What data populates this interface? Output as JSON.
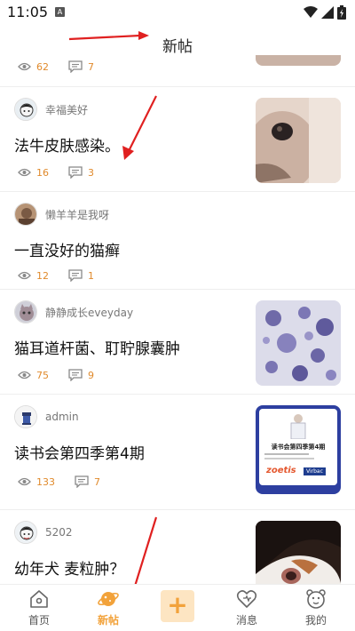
{
  "status_bar": {
    "time": "11:05",
    "notification_label": "A"
  },
  "header": {
    "title": "新帖"
  },
  "partial_post": {
    "views": "62",
    "comments": "7"
  },
  "posts": [
    {
      "author": "幸福美好",
      "title": "法牛皮肤感染。",
      "views": "16",
      "comments": "3",
      "has_thumb": true
    },
    {
      "author": "懒羊羊是我呀",
      "title": "一直没好的猫癣",
      "views": "12",
      "comments": "1",
      "has_thumb": false
    },
    {
      "author": "静静成长eveyday",
      "title": "猫耳道杆菌、耵聍腺囊肿",
      "views": "75",
      "comments": "9",
      "has_thumb": true
    },
    {
      "author": "admin",
      "title": "读书会第四季第4期",
      "views": "133",
      "comments": "7",
      "has_thumb": true,
      "thumb_text": {
        "heading": "读书会第四季第4期",
        "brand1": "zoetis",
        "brand2": "Virbac"
      }
    },
    {
      "author": "5202",
      "title": "幼年犬 麦粒肿？",
      "views": "",
      "comments": "",
      "has_thumb": true
    }
  ],
  "tabbar": {
    "items": [
      {
        "label": "首页",
        "icon": "home-icon",
        "active": false
      },
      {
        "label": "新帖",
        "icon": "planet-icon",
        "active": true
      },
      {
        "label": "+",
        "icon": "add-icon",
        "active": false
      },
      {
        "label": "消息",
        "icon": "heart-icon",
        "active": false
      },
      {
        "label": "我的",
        "icon": "bear-face-icon",
        "active": false
      }
    ]
  },
  "colors": {
    "accent": "#f2a23a",
    "stat": "#e08a2c",
    "annotation_arrow": "#e02020"
  }
}
